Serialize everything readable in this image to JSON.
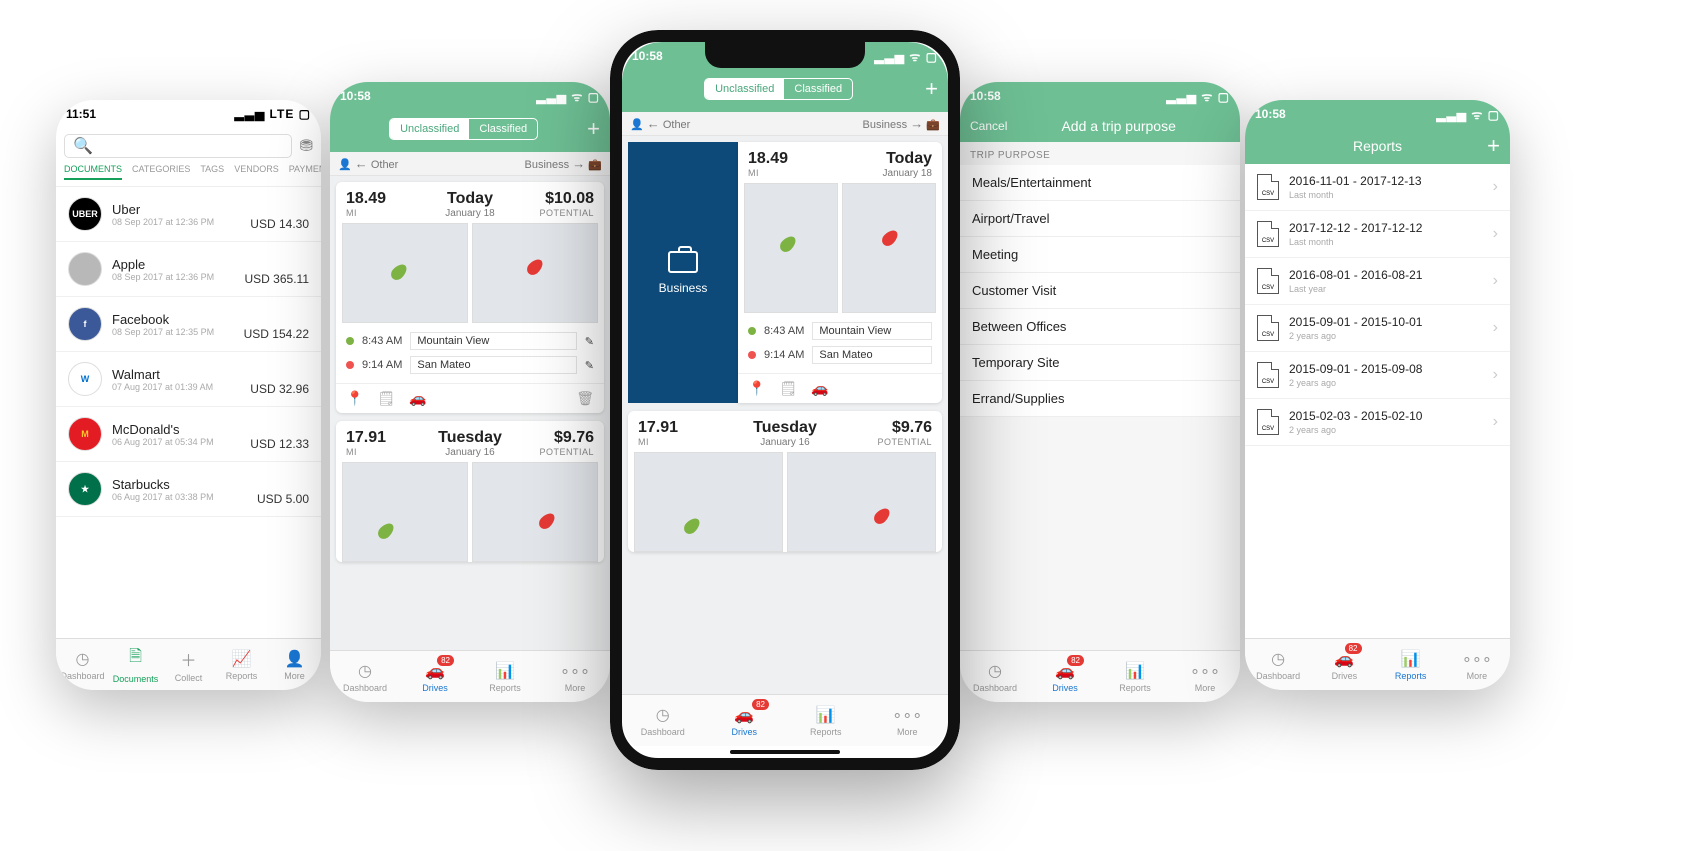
{
  "status_time": "10:58",
  "status_time_p1": "11:51",
  "status_carrier_p1": "LTE",
  "signal_icons": "▂▃▅ ᯤ ▢",
  "seg_unclassified": "Unclassified",
  "seg_classified": "Classified",
  "toolbar_other": "Other",
  "toolbar_business": "Business",
  "swipe_label": "Business",
  "trip1": {
    "miles": "18.49",
    "mi_label": "MI",
    "day": "Today",
    "date": "January 18",
    "potential": "$10.08",
    "pot_label": "POTENTIAL",
    "t1": "8:43 AM",
    "loc1": "Mountain View",
    "t2": "9:14 AM",
    "loc2": "San Mateo"
  },
  "trip2": {
    "miles": "17.91",
    "mi_label": "MI",
    "day": "Tuesday",
    "date": "January 16",
    "potential": "$9.76",
    "pot_label": "POTENTIAL"
  },
  "tabs": {
    "dashboard": "Dashboard",
    "drives": "Drives",
    "reports": "Reports",
    "more": "More",
    "documents": "Documents",
    "collect": "Collect",
    "badge": "82"
  },
  "doc_tabs": [
    "DOCUMENTS",
    "CATEGORIES",
    "TAGS",
    "VENDORS",
    "PAYMENTS"
  ],
  "docs": [
    {
      "name": "Uber",
      "dt": "08 Sep 2017 at 12:36 PM",
      "amt": "USD 14.30",
      "bg": "#000",
      "fg": "#fff",
      "lbl": "UBER"
    },
    {
      "name": "Apple",
      "dt": "08 Sep 2017 at 12:36 PM",
      "amt": "USD 365.11",
      "bg": "#b8b8b8",
      "fg": "#fff",
      "lbl": ""
    },
    {
      "name": "Facebook",
      "dt": "08 Sep 2017 at 12:35 PM",
      "amt": "USD 154.22",
      "bg": "#3b5998",
      "fg": "#fff",
      "lbl": "f"
    },
    {
      "name": "Walmart",
      "dt": "07 Aug 2017 at 01:39 AM",
      "amt": "USD 32.96",
      "bg": "#fff",
      "fg": "#0071ce",
      "lbl": "W"
    },
    {
      "name": "McDonald's",
      "dt": "06 Aug 2017 at 05:34 PM",
      "amt": "USD 12.33",
      "bg": "#e31b23",
      "fg": "#ffc72c",
      "lbl": "M"
    },
    {
      "name": "Starbucks",
      "dt": "06 Aug 2017 at 03:38 PM",
      "amt": "USD 5.00",
      "bg": "#00704a",
      "fg": "#fff",
      "lbl": "★"
    }
  ],
  "purpose_header": "Add a trip purpose",
  "purpose_cancel": "Cancel",
  "purpose_section": "TRIP PURPOSE",
  "purposes": [
    "Meals/Entertainment",
    "Airport/Travel",
    "Meeting",
    "Customer Visit",
    "Between Offices",
    "Temporary Site",
    "Errand/Supplies"
  ],
  "reports_title": "Reports",
  "reports": [
    {
      "title": "2016-11-01 - 2017-12-13",
      "sub": "Last month"
    },
    {
      "title": "2017-12-12 - 2017-12-12",
      "sub": "Last month"
    },
    {
      "title": "2016-08-01 - 2016-08-21",
      "sub": "Last year"
    },
    {
      "title": "2015-09-01 - 2015-10-01",
      "sub": "2 years ago"
    },
    {
      "title": "2015-09-01 - 2015-09-08",
      "sub": "2 years ago"
    },
    {
      "title": "2015-02-03 - 2015-02-10",
      "sub": "2 years ago"
    }
  ],
  "csv_label": "CSV"
}
